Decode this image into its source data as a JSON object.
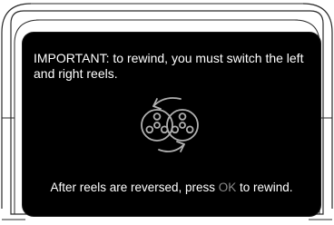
{
  "dialog": {
    "message": "IMPORTANT: to rewind, you must switch the left and right reels.",
    "footer_before": "After reels are reversed, press ",
    "footer_key": "OK",
    "footer_after": " to rewind."
  },
  "icons": {
    "reels": "swap-reels-icon"
  },
  "colors": {
    "screen_background": "#000000",
    "text": "#ffffff",
    "key_highlight": "#8a8a8a",
    "icon_stroke": "#b0b0b0",
    "bezel_stroke": "#2a2a2a"
  }
}
